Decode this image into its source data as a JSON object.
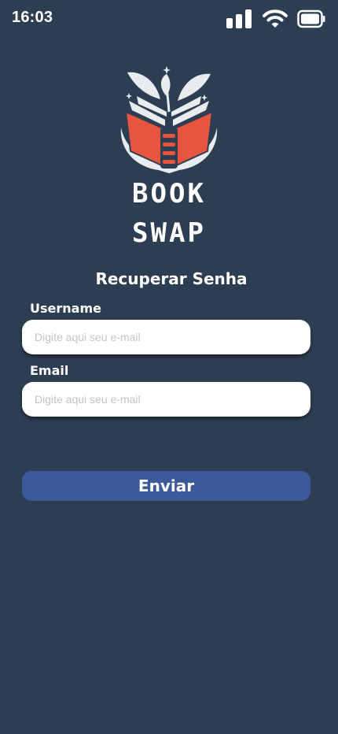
{
  "status_bar": {
    "time": "16:03",
    "icons": [
      "cellular-signal-icon",
      "wifi-icon",
      "battery-icon"
    ]
  },
  "logo": {
    "line1": "BOOK",
    "line2": "SWAP"
  },
  "page_title": "Recuperar Senha",
  "form": {
    "username": {
      "label": "Username",
      "value": "",
      "placeholder": "Digite aqui seu e-mail"
    },
    "email": {
      "label": "Email",
      "value": "",
      "placeholder": "Digite aqui seu e-mail"
    },
    "submit_label": "Enviar"
  },
  "colors": {
    "background": "#2d3e53",
    "button": "#3c5a99",
    "book_cover": "#e8553f",
    "text": "#ffffff"
  }
}
